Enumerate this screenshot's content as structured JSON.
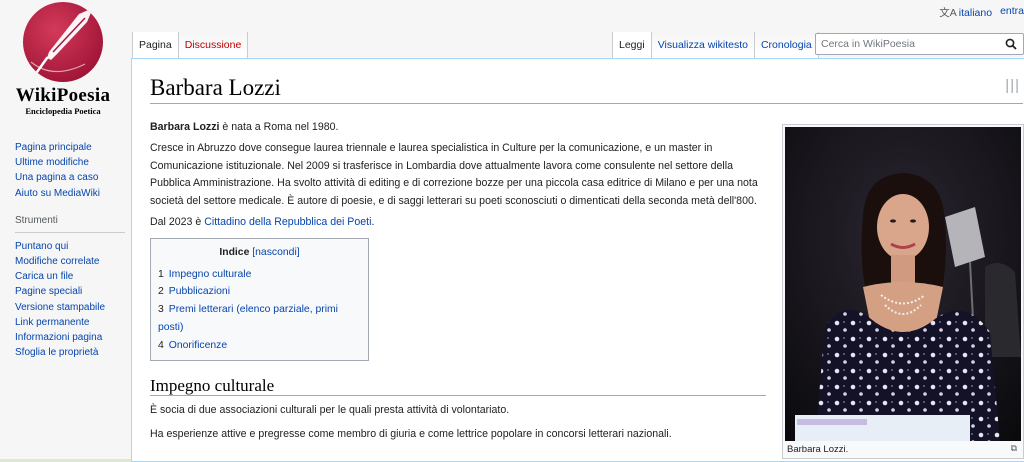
{
  "personal": {
    "language": "italiano",
    "login": "entra"
  },
  "logo": {
    "title": "WikiPoesia",
    "subtitle": "Enciclopedia Poetica"
  },
  "sidebar": {
    "navigation": [
      "Pagina principale",
      "Ultime modifiche",
      "Una pagina a caso",
      "Aiuto su MediaWiki"
    ],
    "tools_heading": "Strumenti",
    "tools": [
      "Puntano qui",
      "Modifiche correlate",
      "Carica un file",
      "Pagine speciali",
      "Versione stampabile",
      "Link permanente",
      "Informazioni pagina",
      "Sfoglia le proprietà"
    ]
  },
  "tabs": {
    "namespaces": [
      "Pagina",
      "Discussione"
    ],
    "views": [
      "Leggi",
      "Visualizza wikitesto",
      "Cronologia"
    ]
  },
  "search": {
    "placeholder": "Cerca in WikiPoesia"
  },
  "article": {
    "title": "Barbara Lozzi",
    "intro_bold": "Barbara Lozzi",
    "intro_rest": " è nata a Roma nel 1980.",
    "para2": "Cresce in Abruzzo dove consegue laurea triennale e laurea specialistica in Culture per la comunicazione, e un master in Comunicazione istituzionale. Nel 2009 si trasferisce in Lombardia dove attualmente lavora come consulente nel settore della Pubblica Amministrazione. Ha svolto attività di editing e di correzione bozze per una piccola casa editrice di Milano e per una nota società del settore medicale. È autore di poesie, e di saggi letterari su poeti sconosciuti o dimenticati della seconda metà dell'800.",
    "para3_pre": "Dal 2023 è ",
    "para3_link": "Cittadino della Repubblica dei Poeti",
    "para3_post": ".",
    "toc": {
      "title": "Indice",
      "toggle": "nascondi",
      "items": [
        {
          "num": "1",
          "label": "Impegno culturale"
        },
        {
          "num": "2",
          "label": "Pubblicazioni"
        },
        {
          "num": "3",
          "label": "Premi letterari (elenco parziale, primi posti)"
        },
        {
          "num": "4",
          "label": "Onorificenze"
        }
      ]
    },
    "section1_title": "Impegno culturale",
    "section1_p1": "È socia di due associazioni culturali per le quali presta attività di volontariato.",
    "section1_p2": "Ha esperienze attive e pregresse come membro di giuria e come lettrice popolare in concorsi letterari nazionali.",
    "thumb_caption": "Barbara Lozzi."
  }
}
